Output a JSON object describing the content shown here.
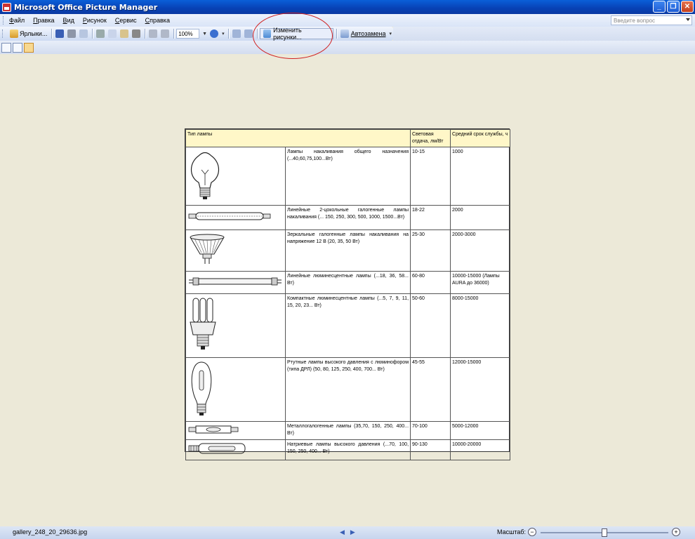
{
  "window": {
    "title": "Microsoft Office Picture Manager",
    "buttons": {
      "minimize": "_",
      "restore": "❐",
      "close": "✕"
    }
  },
  "menu": {
    "items": [
      "Файл",
      "Правка",
      "Вид",
      "Рисунок",
      "Сервис",
      "Справка"
    ],
    "help_placeholder": "Введите вопрос"
  },
  "toolbar": {
    "shortcuts_label": "Ярлыки...",
    "zoom": "100%",
    "edit_pictures_label": "Изменить рисунки...",
    "autocorrect_label": "Автозамена"
  },
  "document": {
    "headers": [
      "Тип лампы",
      "Световая отдача, лм/Вт",
      "Средний срок службы, ч"
    ],
    "rows": [
      {
        "icon": "incandescent-bulb-icon",
        "desc": "Лампы накаливания общего назначения (...40,60,75,100...Вт)",
        "efficacy": "10-15",
        "life": "1000"
      },
      {
        "icon": "linear-halogen-lamp-icon",
        "desc": "Линейные 2-цокольные галогенные лампы накаливания (... 150, 250, 300, 500, 1000, 1500...Вт)",
        "efficacy": "18-22",
        "life": "2000"
      },
      {
        "icon": "reflector-halogen-lamp-icon",
        "desc": "Зеркальные галогенные лампы накаливания на напряжение 12 В (20, 35, 50 Вт)",
        "efficacy": "25-30",
        "life": "2000-3000"
      },
      {
        "icon": "fluorescent-tube-icon",
        "desc": "Линейные люминесцентные лампы (...18, 36, 58... Вт)",
        "efficacy": "60-80",
        "life": "10000-15000 (Лампы AURA до 36000)"
      },
      {
        "icon": "compact-fluorescent-lamp-icon",
        "desc": "Компактные люминесцентные лампы (...5, 7, 9, 11, 15, 20, 23... Вт)",
        "efficacy": "50-60",
        "life": "8000-15000"
      },
      {
        "icon": "mercury-lamp-icon",
        "desc": "Ртутные лампы высокого давления с люминофором (типа ДРЛ) (50, 80, 125, 250, 400, 700... Вт)",
        "efficacy": "45-55",
        "life": "12000-15000"
      },
      {
        "icon": "metal-halide-lamp-icon",
        "desc": "Металлогалогенные лампы (35,70, 150, 250, 400... Вт)",
        "efficacy": "70-100",
        "life": "5000-12000"
      },
      {
        "icon": "sodium-lamp-icon",
        "desc": "Натриевые лампы высокого давления (...70, 100, 150, 250, 400... Вт)",
        "efficacy": "90-130",
        "life": "10000-20000"
      }
    ]
  },
  "status": {
    "filename": "gallery_248_20_29636.jpg",
    "prev": "◀",
    "next": "▶",
    "zoom_label": "Масштаб:",
    "zoom_minus": "−",
    "zoom_plus": "+"
  }
}
